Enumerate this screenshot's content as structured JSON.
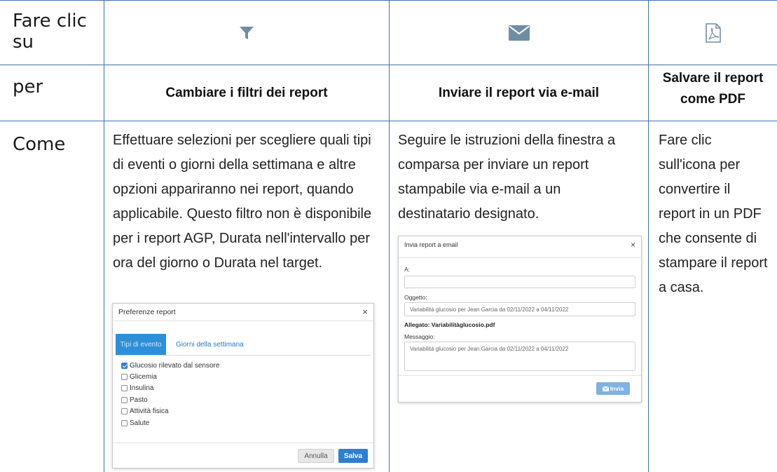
{
  "row_headers": {
    "click": "Fare clic su",
    "for": "per",
    "how": "Come"
  },
  "columns": [
    {
      "icon": "filter-icon",
      "action": "Cambiare i filtri dei report",
      "how": "Effettuare selezioni per scegliere quali tipi di eventi o giorni della settimana e altre opzioni appariranno nei report, quando applicabile. Questo filtro non è disponibile per i report AGP, Durata nell'intervallo per ora del giorno o Durata nel target."
    },
    {
      "icon": "envelope-icon",
      "action": "Inviare il report via e-mail",
      "how": "Seguire le istruzioni della finestra a comparsa per inviare un report stampabile via e-mail a un destinatario designato."
    },
    {
      "icon": "pdf-file-icon",
      "action": "Salvare il report come PDF",
      "how": "Fare clic sull'icona per convertire il report in un PDF che consente di stampare il report a casa."
    }
  ],
  "filter_dialog": {
    "title": "Preferenze report",
    "close": "×",
    "tabs": [
      "Tipi di evento",
      "Giorni della settimana"
    ],
    "options": [
      {
        "label": "Glucosio rilevato dal sensore",
        "checked": true
      },
      {
        "label": "Glicemia",
        "checked": false
      },
      {
        "label": "Insulina",
        "checked": false
      },
      {
        "label": "Pasto",
        "checked": false
      },
      {
        "label": "Attività fisica",
        "checked": false
      },
      {
        "label": "Salute",
        "checked": false
      }
    ],
    "cancel": "Annulla",
    "save": "Salva"
  },
  "email_dialog": {
    "title": "Invia report a email",
    "close": "×",
    "to_label": "A:",
    "to_value": "",
    "subject_label": "Oggetto:",
    "subject_value": "Variabilità glucosio per Jean Garcia da 02/11/2022 a 04/11/2022",
    "attachment": "Allegato: Variabilitàglucosio.pdf",
    "message_label": "Messaggio:",
    "message_value": "Variabilità glucosio per Jean Garcia da 02/11/2022 a 04/11/2022",
    "send": "Invia"
  },
  "colors": {
    "grid_line": "#3f6fb6",
    "icon": "#6f8ea3",
    "primary_button": "#2d7fcf",
    "send_button": "#7fb1e3"
  }
}
